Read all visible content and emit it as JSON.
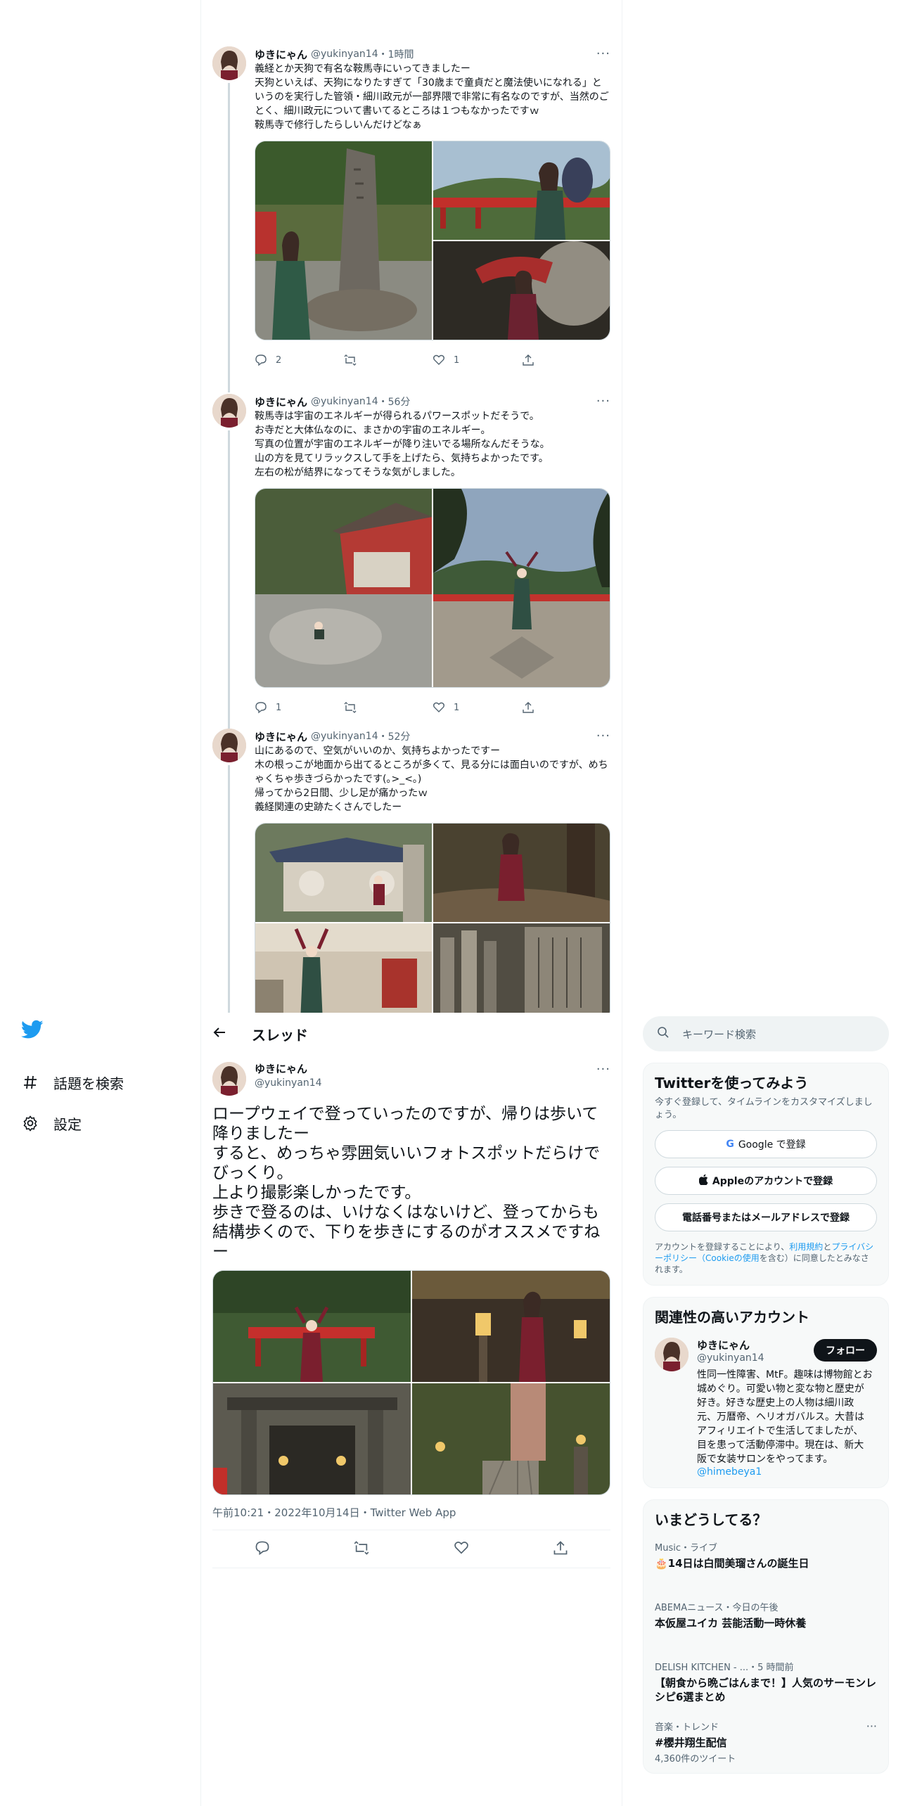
{
  "nav": {
    "items": [
      {
        "label": "話題を検索",
        "icon": "hashtag-icon"
      },
      {
        "label": "設定",
        "icon": "gear-icon"
      }
    ]
  },
  "thread_tweets": [
    {
      "name": "ゆきにゃん",
      "handle": "@yukinyan14",
      "time": "1時間",
      "text": "義経とか天狗で有名な鞍馬寺にいってきましたー\n天狗といえば、天狗になりたすぎて「30歳まで童貞だと魔法使いになれる」というのを実行した管領・細川政元が一部界隈で非常に有名なのですが、当然のごとく、細川政元について書いてるところは１つもなかったですｗ\n鞍馬寺で修行したらしいんだけどなぁ",
      "reply_count": "2",
      "retweet_count": "",
      "like_count": "1"
    },
    {
      "name": "ゆきにゃん",
      "handle": "@yukinyan14",
      "time": "56分",
      "text": "鞍馬寺は宇宙のエネルギーが得られるパワースポットだそうで。\nお寺だと大体仏なのに、まさかの宇宙のエネルギー。\n写真の位置が宇宙のエネルギーが降り注いでる場所なんだそうな。\n山の方を見てリラックスして手を上げたら、気持ちよかったです。\n左右の松が結界になってそうな気がしました。",
      "reply_count": "1",
      "retweet_count": "",
      "like_count": "1"
    },
    {
      "name": "ゆきにゃん",
      "handle": "@yukinyan14",
      "time": "52分",
      "text": "山にあるので、空気がいいのか、気持ちよかったですー\n木の根っこが地面から出てるところが多くて、見る分には面白いのですが、めちゃくちゃ歩きづらかったです(｡>_<｡)\n帰ってから2日間、少し足が痛かったｗ\n義経関連の史跡たくさんでしたー",
      "reply_count": "",
      "retweet_count": "",
      "like_count": ""
    }
  ],
  "thread_header": {
    "title": "スレッド"
  },
  "focal": {
    "name": "ゆきにゃん",
    "handle": "@yukinyan14",
    "text": "ロープウェイで登っていったのですが、帰りは歩いて降りましたー\nすると、めっちゃ雰囲気いいフォトスポットだらけでびっくり。\n上より撮影楽しかったです。\n歩きで登るのは、いけなくはないけど、登ってからも結構歩くので、下りを歩きにするのがオススメですねー",
    "meta": "午前10:21・2022年10月14日・Twitter Web App"
  },
  "search": {
    "placeholder": "キーワード検索"
  },
  "signup": {
    "title": "Twitterを使ってみよう",
    "subtitle": "今すぐ登録して、タイムラインをカスタマイズしましょう。",
    "google": "Google で登録",
    "apple": "Appleのアカウントで登録",
    "phone": "電話番号またはメールアドレスで登録",
    "legal_prefix": "アカウントを登録することにより、",
    "terms": "利用規約",
    "and": "と",
    "privacy": "プライバシーポリシー（Cookieの使用",
    "legal_suffix": "を含む）に同意したとみなされます。"
  },
  "related": {
    "title": "関連性の高いアカウント",
    "name": "ゆきにゃん",
    "handle": "@yukinyan14",
    "follow": "フォロー",
    "bio": "性同一性障害、MtF。趣味は博物館とお城めぐり。可愛い物と変な物と歴史が好き。好きな歴史上の人物は細川政元、万暦帝、ヘリオガバルス。大昔はアフィリエイトで生活してましたが、目を患って活動停滞中。現在は、新大阪で女装サロンをやってます。",
    "link": "@himebeya1"
  },
  "trends": {
    "title": "いまどうしてる？",
    "items": [
      {
        "context": "Music・ライブ",
        "title": "🎂14日は白間美瑠さんの誕生日",
        "count": ""
      },
      {
        "context": "ABEMAニュース・今日の午後",
        "title": "本仮屋ユイカ 芸能活動一時休養",
        "count": ""
      },
      {
        "context": "DELISH KITCHEN - ...・5 時間前",
        "title": "【朝食から晩ごはんまで！】人気のサーモンレシピ6選まとめ",
        "count": ""
      },
      {
        "context": "音楽・トレンド",
        "title": "#櫻井翔生配信",
        "count": "4,360件のツイート"
      }
    ]
  },
  "colors": {
    "accent": "#1d9bf0",
    "text": "#0f1419",
    "muted": "#536471"
  }
}
